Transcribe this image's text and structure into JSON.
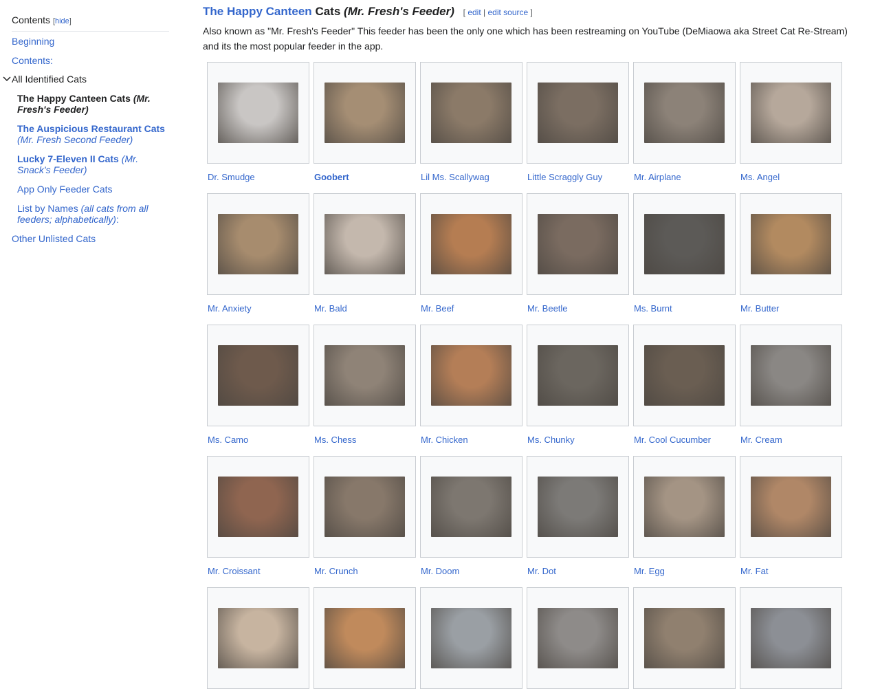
{
  "toc": {
    "title": "Contents",
    "hide_label": "hide",
    "items": [
      {
        "label": "Beginning"
      },
      {
        "label": "Contents:"
      },
      {
        "label": "All Identified Cats"
      },
      {
        "label": "The Happy Canteen Cats",
        "note": "(Mr. Fresh's Feeder)"
      },
      {
        "label": "The Auspicious Restaurant Cats",
        "note": "(Mr. Fresh Second Feeder)"
      },
      {
        "label": "Lucky 7-Eleven II Cats",
        "note": "(Mr. Snack's Feeder)"
      },
      {
        "label": "App Only Feeder Cats"
      },
      {
        "label": "List by Names",
        "note": "(all cats from all feeders; alphabetically)",
        "suffix": ":"
      },
      {
        "label": "Other Unlisted Cats"
      }
    ]
  },
  "section": {
    "title_link": "The Happy Canteen",
    "title_rest": "Cats",
    "title_sub": "(Mr. Fresh's Feeder)",
    "edit_label": "edit",
    "edit_source_label": "edit source",
    "intro": "Also known as \"Mr. Fresh's Feeder\" This feeder has been the only one which has been restreaming on YouTube (DeMiaowa aka Street Cat Re-Stream) and its the most popular feeder in the app."
  },
  "gallery": {
    "captions": [
      "Dr. Smudge",
      "Goobert",
      "Lil Ms. Scallywag",
      "Little Scraggly Guy",
      "Mr. Airplane",
      "Ms. Angel",
      "Mr. Anxiety",
      "Mr. Bald",
      "Mr. Beef",
      "Mr. Beetle",
      "Ms. Burnt",
      "Mr. Butter",
      "Ms. Camo",
      "Ms. Chess",
      "Mr. Chicken",
      "Ms. Chunky",
      "Mr. Cool Cucumber",
      "Mr. Cream",
      "Mr. Croissant",
      "Mr. Crunch",
      "Mr. Doom",
      "Mr. Dot",
      "Mr. Egg",
      "Mr. Fat"
    ],
    "thumb_colors": [
      "#c9c6c4",
      "#a58e74",
      "#8b7a68",
      "#7b6e62",
      "#8c8278",
      "#b6a89b",
      "#a78c6e",
      "#c4b8ad",
      "#b57d52",
      "#7a6b60",
      "#5c5a57",
      "#b28a60",
      "#6e5a4c",
      "#8f8377",
      "#b47e57",
      "#6b665f",
      "#6a5e52",
      "#8a8784",
      "#8f6550",
      "#87786a",
      "#7d7770",
      "#7c7a77",
      "#a49484",
      "#b08767",
      "#c7b4a0",
      "#c08a5c",
      "#9a9fa4",
      "#8e8b89",
      "#90806f",
      "#8c8f95"
    ]
  },
  "colors": {
    "link": "#3366cc",
    "text": "#202122",
    "border": "#c8ccd1",
    "thumb_bg": "#f8f9fa"
  }
}
